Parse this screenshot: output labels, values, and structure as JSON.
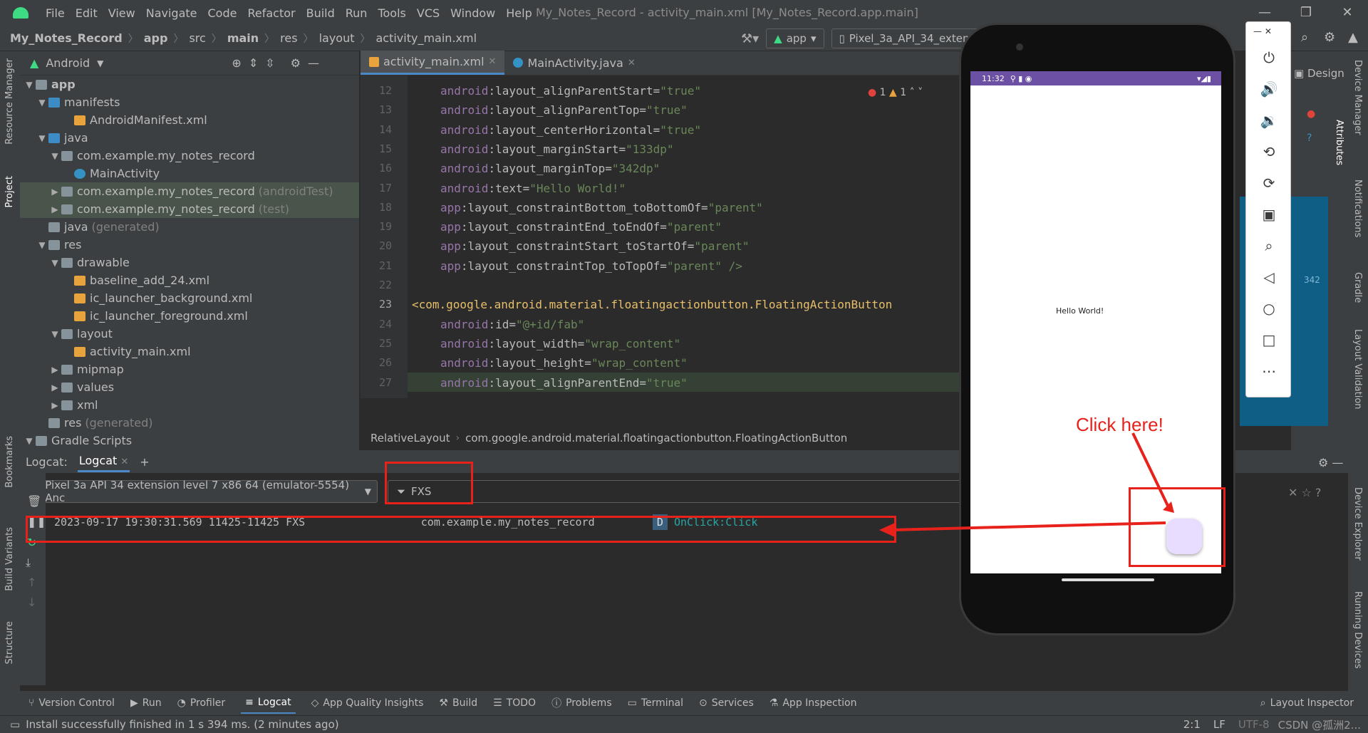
{
  "menu": {
    "items": [
      "File",
      "Edit",
      "View",
      "Navigate",
      "Code",
      "Refactor",
      "Build",
      "Run",
      "Tools",
      "VCS",
      "Window",
      "Help"
    ],
    "title": "My_Notes_Record - activity_main.xml [My_Notes_Record.app.main]"
  },
  "navbar": {
    "crumbs": [
      "My_Notes_Record",
      "app",
      "src",
      "main",
      "res",
      "layout",
      "activity_main.xml"
    ],
    "run_config": "app",
    "device": "Pixel_3a_API_34_extens"
  },
  "left_strip": [
    "Resource Manager",
    "Project",
    "Bookmarks",
    "Build Variants",
    "Structure"
  ],
  "right_strip": [
    "Device Manager",
    "Notifications",
    "Gradle",
    "Layout Validation",
    "Device Explorer",
    "Running Devices"
  ],
  "project": {
    "view": "Android",
    "tree": [
      {
        "label": "app",
        "depth": 0,
        "arrow": "▼",
        "icon": "fold",
        "bold": true
      },
      {
        "label": "manifests",
        "depth": 1,
        "arrow": "▼",
        "icon": "fold2"
      },
      {
        "label": "AndroidManifest.xml",
        "depth": 3,
        "arrow": "",
        "icon": "xml"
      },
      {
        "label": "java",
        "depth": 1,
        "arrow": "▼",
        "icon": "fold2"
      },
      {
        "label": "com.example.my_notes_record",
        "depth": 2,
        "arrow": "▼",
        "icon": "fold"
      },
      {
        "label": "MainActivity",
        "depth": 3,
        "arrow": "",
        "icon": "cls"
      },
      {
        "label": "com.example.my_notes_record",
        "suffix": "(androidTest)",
        "depth": 2,
        "arrow": "▶",
        "icon": "fold",
        "sel": true
      },
      {
        "label": "com.example.my_notes_record",
        "suffix": "(test)",
        "depth": 2,
        "arrow": "▶",
        "icon": "fold",
        "sel": true
      },
      {
        "label": "java",
        "suffix": "(generated)",
        "depth": 1,
        "arrow": "",
        "icon": "fold"
      },
      {
        "label": "res",
        "depth": 1,
        "arrow": "▼",
        "icon": "fold"
      },
      {
        "label": "drawable",
        "depth": 2,
        "arrow": "▼",
        "icon": "fold"
      },
      {
        "label": "baseline_add_24.xml",
        "depth": 3,
        "arrow": "",
        "icon": "xml"
      },
      {
        "label": "ic_launcher_background.xml",
        "depth": 3,
        "arrow": "",
        "icon": "xml"
      },
      {
        "label": "ic_launcher_foreground.xml",
        "depth": 3,
        "arrow": "",
        "icon": "xml"
      },
      {
        "label": "layout",
        "depth": 2,
        "arrow": "▼",
        "icon": "fold"
      },
      {
        "label": "activity_main.xml",
        "depth": 3,
        "arrow": "",
        "icon": "xml"
      },
      {
        "label": "mipmap",
        "depth": 2,
        "arrow": "▶",
        "icon": "fold"
      },
      {
        "label": "values",
        "depth": 2,
        "arrow": "▶",
        "icon": "fold"
      },
      {
        "label": "xml",
        "depth": 2,
        "arrow": "▶",
        "icon": "fold"
      },
      {
        "label": "res",
        "suffix": "(generated)",
        "depth": 1,
        "arrow": "",
        "icon": "fold"
      },
      {
        "label": "Gradle Scripts",
        "depth": 0,
        "arrow": "▼",
        "icon": "fold"
      }
    ]
  },
  "editor": {
    "tabs": [
      "activity_main.xml",
      "MainActivity.java"
    ],
    "inspection": {
      "errors": "1",
      "warnings": "1"
    },
    "lines": [
      {
        "n": "12",
        "ns": "android",
        "attr": ":layout_alignParentStart=",
        "val": "\"true\""
      },
      {
        "n": "13",
        "ns": "android",
        "attr": ":layout_alignParentTop=",
        "val": "\"true\""
      },
      {
        "n": "14",
        "ns": "android",
        "attr": ":layout_centerHorizontal=",
        "val": "\"true\""
      },
      {
        "n": "15",
        "ns": "android",
        "attr": ":layout_marginStart=",
        "val": "\"133dp\""
      },
      {
        "n": "16",
        "ns": "android",
        "attr": ":layout_marginTop=",
        "val": "\"342dp\""
      },
      {
        "n": "17",
        "ns": "android",
        "attr": ":text=",
        "val": "\"Hello World!\""
      },
      {
        "n": "18",
        "ns": "app",
        "attr": ":layout_constraintBottom_toBottomOf=",
        "val": "\"parent\""
      },
      {
        "n": "19",
        "ns": "app",
        "attr": ":layout_constraintEnd_toEndOf=",
        "val": "\"parent\""
      },
      {
        "n": "20",
        "ns": "app",
        "attr": ":layout_constraintStart_toStartOf=",
        "val": "\"parent\""
      },
      {
        "n": "21",
        "ns": "app",
        "attr": ":layout_constraintTop_toTopOf=",
        "val": "\"parent\" />"
      },
      {
        "n": "22",
        "ns": "",
        "attr": "",
        "val": ""
      },
      {
        "n": "23",
        "tag": "<com.google.android.material.floatingactionbutton.FloatingActionButton"
      },
      {
        "n": "24",
        "ns": "android",
        "attr": ":id=",
        "val": "\"@+id/fab\""
      },
      {
        "n": "25",
        "ns": "android",
        "attr": ":layout_width=",
        "val": "\"wrap_content\""
      },
      {
        "n": "26",
        "ns": "android",
        "attr": ":layout_height=",
        "val": "\"wrap_content\""
      },
      {
        "n": "27",
        "ns": "android",
        "attr": ":layout_alignParentEnd=",
        "val": "\"true\""
      }
    ],
    "breadcrumbs": [
      "RelativeLayout",
      "com.google.android.material.floatingactionbutton.FloatingActionButton"
    ],
    "design_label": "Design",
    "attributes_label": "Attributes",
    "blueprint_value": "342"
  },
  "logcat": {
    "label": "Logcat:",
    "tab": "Logcat",
    "device": "Pixel 3a API 34 extension level 7 x86 64 (emulator-5554) Anc",
    "filter": "FXS",
    "entry": {
      "datetime": "2023-09-17 19:30:31.569",
      "pid": "11425-11425",
      "tag": "FXS",
      "package": "com.example.my_notes_record",
      "level": "D",
      "message": "OnClick:Click"
    }
  },
  "bottom_tools": [
    "Version Control",
    "Run",
    "Profiler",
    "Logcat",
    "App Quality Insights",
    "Build",
    "TODO",
    "Problems",
    "Terminal",
    "Services",
    "App Inspection"
  ],
  "layout_inspector": "Layout Inspector",
  "status": {
    "message": "Install successfully finished in 1 s 394 ms. (2 minutes ago)",
    "position": "2:1",
    "line_sep": "LF",
    "encoding": "UTF-8",
    "watermark": "CSDN @孤洲2..."
  },
  "emulator": {
    "time": "11:32",
    "hello": "Hello World!",
    "fab_color": "#e9ddff",
    "statusbar_color": "#6b50a3"
  },
  "annotation": {
    "text": "Click here!",
    "color": "#e8221b"
  }
}
